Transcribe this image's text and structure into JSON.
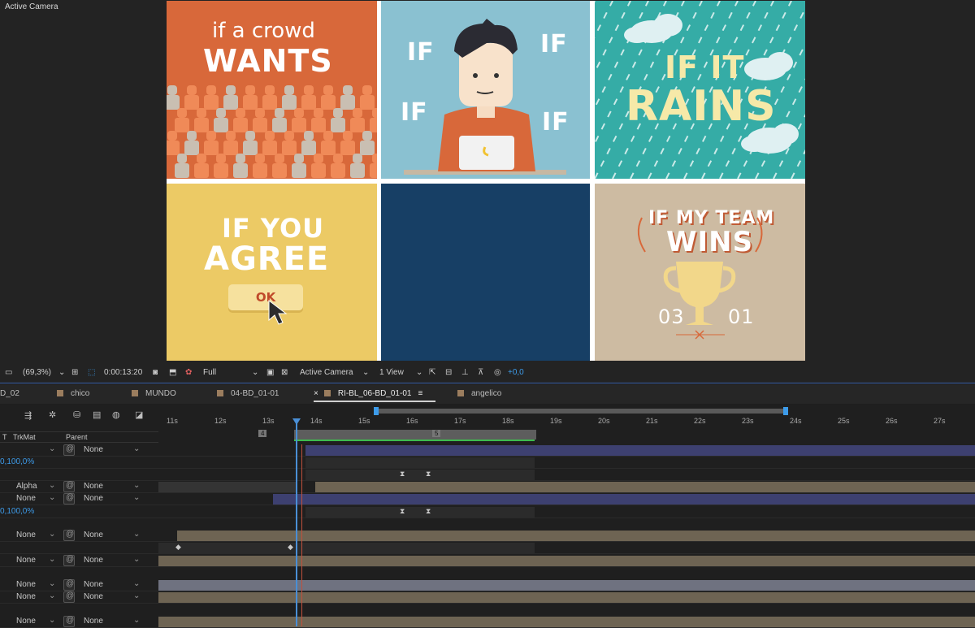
{
  "viewer": {
    "label": "Active Camera"
  },
  "comp": {
    "panel1": {
      "line1": "if a crowd",
      "line2": "WANTS"
    },
    "panel2": {
      "if1": "IF",
      "if2": "IF",
      "if3": "IF",
      "if4": "IF"
    },
    "panel3": {
      "line1": "IF IT",
      "line2": "RAINS"
    },
    "panel4": {
      "line1": "IF YOU",
      "line2": "AGREE",
      "button": "OK"
    },
    "panel6": {
      "line1": "IF MY TEAM",
      "line2": "WINS",
      "score_left": "03",
      "score_right": "01"
    }
  },
  "toolbar": {
    "zoom": "(69,3%)",
    "timecode": "0:00:13:20",
    "resolution": "Full",
    "camera": "Active Camera",
    "views": "1 View",
    "exposure": "+0,0"
  },
  "tabs": [
    {
      "label": "D_02"
    },
    {
      "label": "chico"
    },
    {
      "label": "MUNDO"
    },
    {
      "label": "04-BD_01-01"
    },
    {
      "label": "RI-BL_06-BD_01-01",
      "active": true,
      "close": "×",
      "menu": "≡"
    },
    {
      "label": "angelico"
    }
  ],
  "timeline": {
    "ruler": [
      "11s",
      "12s",
      "13s",
      "14s",
      "15s",
      "16s",
      "17s",
      "18s",
      "19s",
      "20s",
      "21s",
      "22s",
      "23s",
      "24s",
      "25s",
      "26s",
      "27s"
    ],
    "markers": [
      "4",
      "5"
    ],
    "columns": {
      "t": "T",
      "trkmat": "TrkMat",
      "parent": "Parent"
    },
    "rows": [
      {
        "trkmat": "",
        "parent": "None"
      },
      {
        "value": "0,100,0%"
      },
      {
        "trkmat": "Alpha",
        "parent": "None"
      },
      {
        "trkmat": "None",
        "parent": "None"
      },
      {
        "value": "0,100,0%"
      },
      {
        "trkmat": "None",
        "parent": "None"
      },
      {
        "trkmat": "None",
        "parent": "None"
      },
      {
        "trkmat": "None",
        "parent": "None"
      },
      {
        "trkmat": "None",
        "parent": "None"
      },
      {
        "trkmat": "None",
        "parent": "None"
      }
    ]
  },
  "colors": {
    "accent": "#3d9be9",
    "layerBlue": "#3d4070",
    "layerTan": "#6e6453",
    "playhead": "#4a8fd6"
  }
}
